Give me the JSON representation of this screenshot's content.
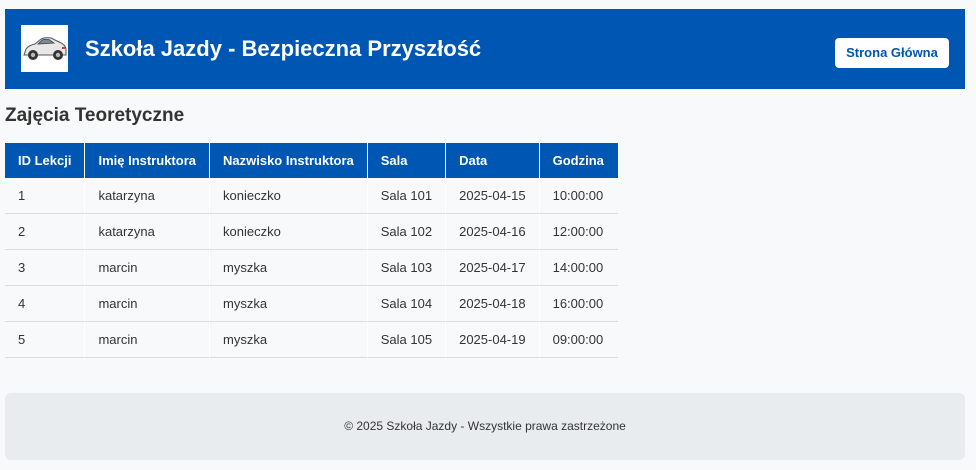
{
  "header": {
    "title": "Szkoła Jazdy - Bezpieczna Przyszłość",
    "logo_icon": "car-icon",
    "home_button_label": "Strona Główna",
    "background_color": "#0056b3"
  },
  "main": {
    "section_title": "Zajęcia Teoretyczne",
    "table": {
      "columns": [
        "ID Lekcji",
        "Imię Instruktora",
        "Nazwisko Instruktora",
        "Sala",
        "Data",
        "Godzina"
      ],
      "rows": [
        [
          "1",
          "katarzyna",
          "konieczko",
          "Sala 101",
          "2025-04-15",
          "10:00:00"
        ],
        [
          "2",
          "katarzyna",
          "konieczko",
          "Sala 102",
          "2025-04-16",
          "12:00:00"
        ],
        [
          "3",
          "marcin",
          "myszka",
          "Sala 103",
          "2025-04-17",
          "14:00:00"
        ],
        [
          "4",
          "marcin",
          "myszka",
          "Sala 104",
          "2025-04-18",
          "16:00:00"
        ],
        [
          "5",
          "marcin",
          "myszka",
          "Sala 105",
          "2025-04-19",
          "09:00:00"
        ]
      ]
    }
  },
  "footer": {
    "text": "© 2025 Szkoła Jazdy - Wszystkie prawa zastrzeżone"
  }
}
